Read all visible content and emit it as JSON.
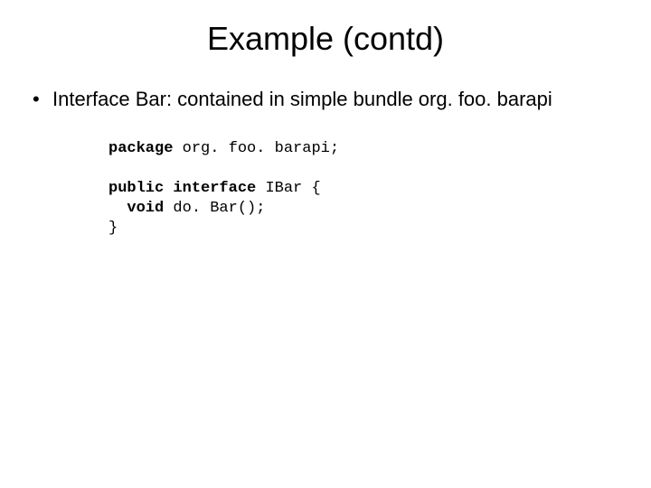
{
  "title": "Example (contd)",
  "bullet1": "Interface Bar: contained in simple bundle org. foo. barapi",
  "code": {
    "l1_kw": "package",
    "l1_rest": " org. foo. barapi;",
    "l2_kw1": "public",
    "l2_mid": " ",
    "l2_kw2": "interface",
    "l2_rest": " IBar {",
    "l3_indent": "  ",
    "l3_kw": "void",
    "l3_rest": " do. Bar();",
    "l4": "}"
  }
}
